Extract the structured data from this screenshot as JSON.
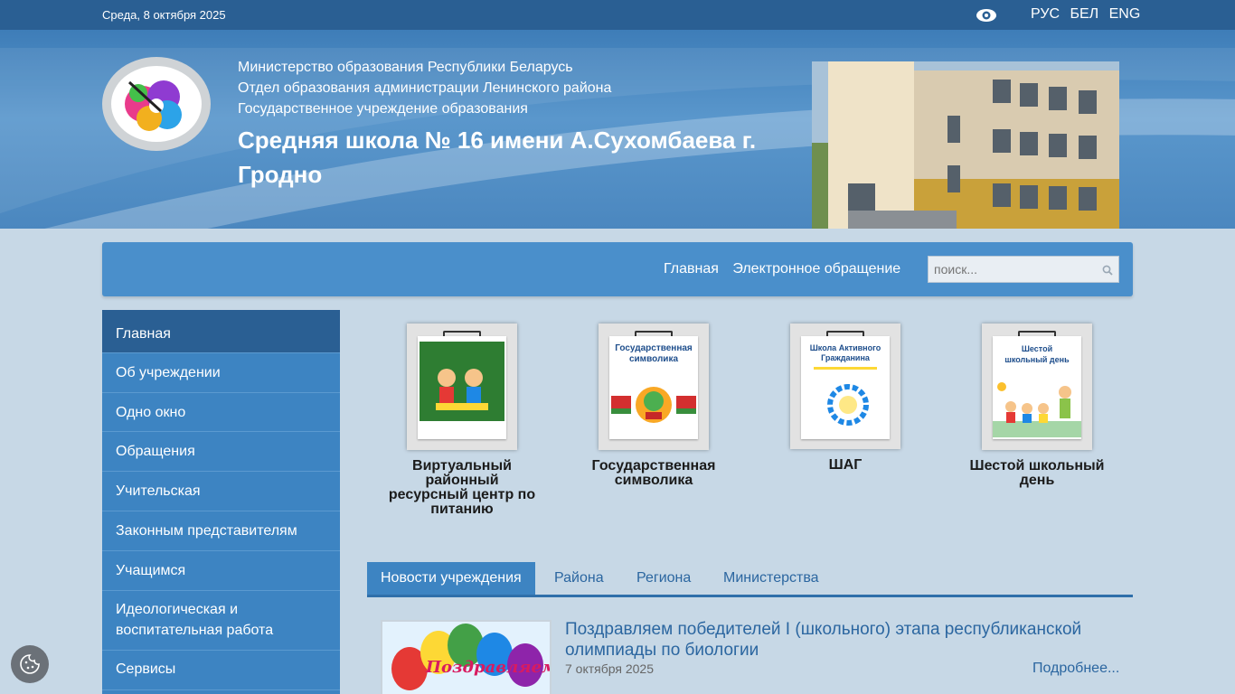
{
  "topbar": {
    "date": "Среда, 8 октября 2025",
    "accessibility_icon": "eye-icon",
    "languages": [
      "РУС",
      "БЕЛ",
      "ENG"
    ]
  },
  "header": {
    "line1": "Министерство образования Республики Беларусь",
    "line2": "Отдел образования администрации Ленинского района",
    "line3": "Государственное учреждение образования",
    "school_name": "Средняя школа № 16 имени А.Сухомбаева г. Гродно"
  },
  "nav": {
    "links": [
      "Главная",
      "Электронное обращение"
    ],
    "search_placeholder": "поиск...",
    "search_icon": "magnifier-icon"
  },
  "sidebar": {
    "items": [
      {
        "label": "Главная",
        "active": true
      },
      {
        "label": "Об учреждении"
      },
      {
        "label": "Одно окно"
      },
      {
        "label": "Обращения"
      },
      {
        "label": "Учительская"
      },
      {
        "label": "Законным представителям"
      },
      {
        "label": "Учащимся"
      },
      {
        "label": "Идеологическая и воспитательная работа"
      },
      {
        "label": "Сервисы"
      }
    ]
  },
  "tiles": [
    {
      "caption": "Виртуальный районный ресурсный центр по питанию"
    },
    {
      "caption": "Государственная символика",
      "paper_text": "Государственная символика"
    },
    {
      "caption": "ШАГ",
      "paper_text": "Школа Активного Гражданина"
    },
    {
      "caption": "Шестой школьный день",
      "paper_text": "Шестой школьный день"
    }
  ],
  "tabs": [
    "Новости учреждения",
    "Района",
    "Региона",
    "Министерства"
  ],
  "news": {
    "title": "Поздравляем победителей I (школьного) этапа республиканской олимпиады по биологии",
    "date": "7 октября 2025",
    "more": "Подробнее...",
    "image_text": "Поздравляем!"
  },
  "colors": {
    "topbar": "#2a5f93",
    "accent": "#3d84c2",
    "link": "#2b66a0"
  }
}
